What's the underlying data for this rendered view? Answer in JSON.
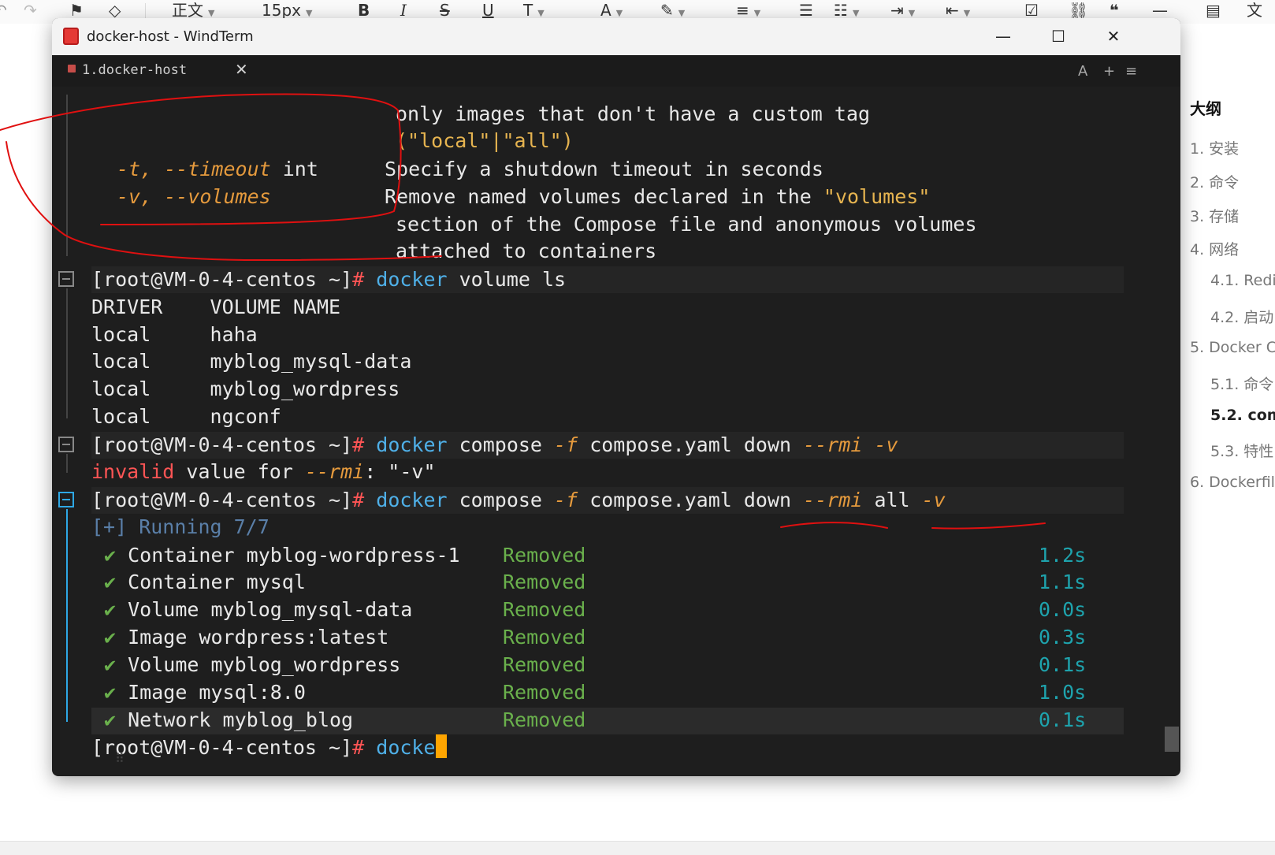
{
  "editor_toolbar": {
    "items": [
      {
        "icon": "format-painter-icon",
        "glyph": "⚑"
      },
      {
        "icon": "eraser-icon",
        "glyph": "◇"
      },
      {
        "label": "正文"
      },
      {
        "label": "15px"
      },
      {
        "label": "B"
      },
      {
        "label": "I"
      },
      {
        "label": "S"
      },
      {
        "label": "U"
      },
      {
        "label": "T"
      },
      {
        "label": "A"
      },
      {
        "icon": "highlighter-icon",
        "glyph": "✎"
      },
      {
        "icon": "align-icon",
        "glyph": "≡"
      },
      {
        "icon": "bullet-list-icon",
        "glyph": "☰"
      },
      {
        "icon": "ordered-list-icon",
        "glyph": "☷"
      },
      {
        "icon": "indent-icon",
        "glyph": "⇥"
      },
      {
        "icon": "outdent-icon",
        "glyph": "⇤"
      },
      {
        "icon": "task-icon",
        "glyph": "☑"
      },
      {
        "icon": "link-icon",
        "glyph": "⛓"
      },
      {
        "icon": "quote-icon",
        "glyph": "❝"
      },
      {
        "icon": "divider-icon",
        "glyph": "—"
      },
      {
        "icon": "outline-toggle-icon",
        "glyph": "▤"
      },
      {
        "icon": "translate-icon",
        "glyph": "文"
      }
    ]
  },
  "outline": {
    "title": "大纲",
    "items": [
      {
        "label": "1. 安装"
      },
      {
        "label": "2. 命令"
      },
      {
        "label": "3. 存储"
      },
      {
        "label": "4. 网络"
      },
      {
        "label": "4.1. Redi"
      },
      {
        "label": "4.2. 启动"
      },
      {
        "label": "5. Docker C"
      },
      {
        "label": "5.1. 命令"
      },
      {
        "label": "5.2. com"
      },
      {
        "label": "5.3. 特性"
      },
      {
        "label": "6. Dockerfil"
      }
    ],
    "active_index": 8
  },
  "window": {
    "title": "docker-host - WindTerm",
    "minimize": "—",
    "maximize": "☐",
    "close": "✕"
  },
  "tabbar": {
    "tab_label": "1.docker-host",
    "tab_close": "✕",
    "right_a": "A",
    "right_plus": "+",
    "right_menu": "≡"
  },
  "terminal": {
    "prompt": "[root@VM-0-4-centos ~]",
    "hash": "#",
    "help": {
      "l1": "only images that don't have a custom tag",
      "l2": "(\"local\"|\"all\")",
      "timeout_flag": "-t, --timeout",
      "timeout_type": "int",
      "timeout_desc": "Specify a shutdown timeout in seconds",
      "volumes_flag": "-v, --volumes",
      "volumes_desc_a": "Remove named volumes declared in the ",
      "volumes_desc_q": "\"volumes\"",
      "l5": "section of the Compose file and anonymous volumes",
      "l6": "attached to containers"
    },
    "cmd1": {
      "a": "docker",
      "b": " volume ls"
    },
    "volume_table": {
      "header": "DRIVER    VOLUME NAME",
      "rows": [
        {
          "driver": "local",
          "name": "haha"
        },
        {
          "driver": "local",
          "name": "myblog_mysql-data"
        },
        {
          "driver": "local",
          "name": "myblog_wordpress"
        },
        {
          "driver": "local",
          "name": "ngconf"
        }
      ]
    },
    "cmd2": {
      "a": "docker",
      "b": " compose ",
      "c": "-f",
      "d": " compose.yaml down ",
      "e": "--rmi -v"
    },
    "err": {
      "a": "invalid",
      "b": " value for ",
      "c": "--rmi",
      "d": ": \"-v\""
    },
    "cmd3": {
      "a": "docker",
      "b": " compose ",
      "c": "-f",
      "d": " compose.yaml down ",
      "e": "--rmi",
      "f": " all ",
      "g": "-v"
    },
    "running": "[+] Running 7/7",
    "check": "✔",
    "results": [
      {
        "obj": "Container myblog-wordpress-1",
        "status": "Removed",
        "time": "1.2s"
      },
      {
        "obj": "Container mysql",
        "status": "Removed",
        "time": "1.1s"
      },
      {
        "obj": "Volume myblog_mysql-data",
        "status": "Removed",
        "time": "0.0s"
      },
      {
        "obj": "Image wordpress:latest",
        "status": "Removed",
        "time": "0.3s"
      },
      {
        "obj": "Volume myblog_wordpress",
        "status": "Removed",
        "time": "0.1s"
      },
      {
        "obj": "Image mysql:8.0",
        "status": "Removed",
        "time": "1.0s"
      },
      {
        "obj": "Network myblog_blog",
        "status": "Removed",
        "time": "0.1s"
      }
    ],
    "current_input": "docke"
  },
  "colors": {
    "annotation_ink": "#e01010",
    "cursor": "#ffa500"
  }
}
